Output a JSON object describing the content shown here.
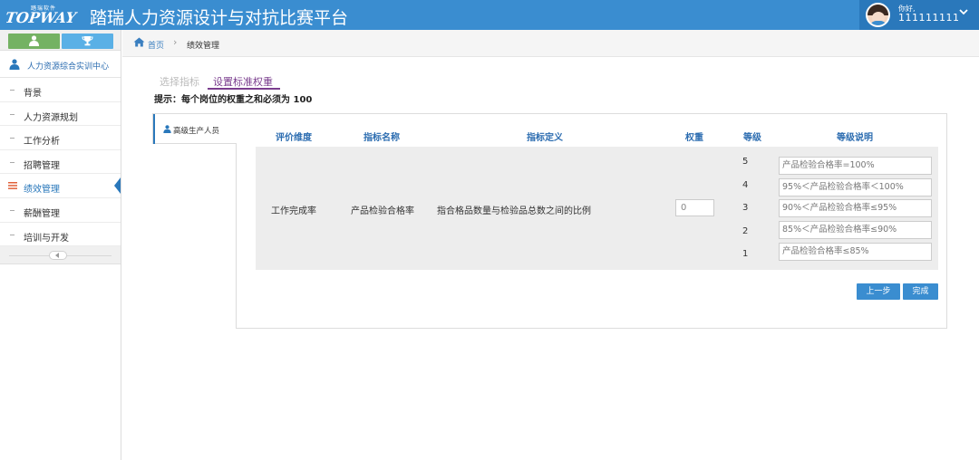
{
  "header": {
    "logo_small": "踏瑞软件",
    "logo_text": "TOPWAY",
    "title": "踏瑞人力资源设计与对抗比赛平台",
    "user": {
      "greeting": "你好,",
      "name": "111111111"
    },
    "icons": {
      "menu_toggle": "chevron-down-icon"
    }
  },
  "sidebar": {
    "top_buttons": [
      {
        "icon": "user-icon",
        "color": "#74b263"
      },
      {
        "icon": "trophy-icon",
        "color": "#5ab0e6"
      }
    ],
    "section_title": "人力资源综合实训中心",
    "items": [
      {
        "label": "背景"
      },
      {
        "label": "人力资源规划"
      },
      {
        "label": "工作分析"
      },
      {
        "label": "招聘管理"
      },
      {
        "label": "绩效管理",
        "active": true
      },
      {
        "label": "薪酬管理"
      },
      {
        "label": "培训与开发"
      }
    ]
  },
  "breadcrumb": {
    "home": "首页",
    "current": "绩效管理"
  },
  "steps": {
    "step1": "选择指标",
    "step2": "设置标准权重"
  },
  "hint": "提示：每个岗位的权重之和必须为 100",
  "position_tab": "高级生产人员",
  "table": {
    "headers": {
      "dimension": "评价维度",
      "name": "指标名称",
      "definition": "指标定义",
      "weight": "权重",
      "level": "等级",
      "level_desc": "等级说明"
    },
    "row": {
      "dimension": "工作完成率",
      "name": "产品检验合格率",
      "definition": "指合格品数量与检验品总数之间的比例",
      "weight": "0",
      "levels": [
        {
          "num": "5",
          "desc": "产品检验合格率=100%"
        },
        {
          "num": "4",
          "desc": "95%＜产品检验合格率＜100%"
        },
        {
          "num": "3",
          "desc": "90%＜产品检验合格率≤95%"
        },
        {
          "num": "2",
          "desc": "85%＜产品检验合格率≤90%"
        },
        {
          "num": "1",
          "desc": "产品检验合格率≤85%"
        }
      ]
    }
  },
  "buttons": {
    "prev": "上一步",
    "done": "完成"
  },
  "colors": {
    "header": "#3a8dd0",
    "accent_purple": "#7a3d8e",
    "link_blue": "#2b6cb0"
  }
}
